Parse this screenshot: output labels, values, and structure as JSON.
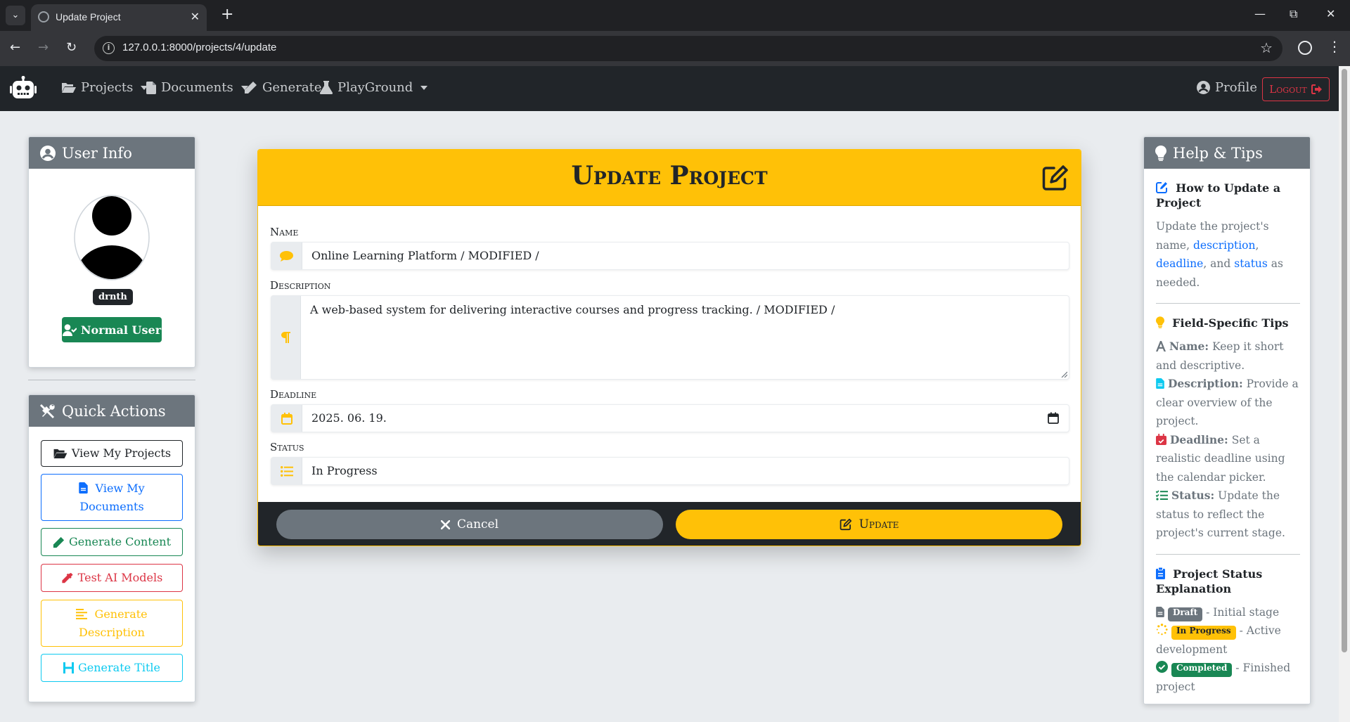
{
  "browser": {
    "tab_title": "Update Project",
    "url": "127.0.0.1:8000/projects/4/update"
  },
  "navbar": {
    "items": [
      {
        "label": "Projects",
        "icon": "folder-open-icon",
        "dropdown": true
      },
      {
        "label": "Documents",
        "icon": "file-icon",
        "dropdown": true
      },
      {
        "label": "Generate",
        "icon": "pencil-icon",
        "dropdown": false
      },
      {
        "label": "PlayGround",
        "icon": "flask-icon",
        "dropdown": true
      }
    ],
    "profile_label": "Profile",
    "logout_label": "Logout"
  },
  "user_info": {
    "title": "User Info",
    "username": "drnth",
    "role": "Normal User"
  },
  "quick_actions": {
    "title": "Quick Actions",
    "buttons": [
      {
        "label": "View My Projects",
        "icon": "folder-open-icon",
        "color": "#212529"
      },
      {
        "label": "View My Documents",
        "icon": "file-icon",
        "color": "#0d6efd"
      },
      {
        "label": "Generate Content",
        "icon": "pencil-icon",
        "color": "#198754"
      },
      {
        "label": "Test AI Models",
        "icon": "eyedropper-icon",
        "color": "#dc3545"
      },
      {
        "label": "Generate Description",
        "icon": "align-left-icon",
        "color": "#ffc107"
      },
      {
        "label": "Generate Title",
        "icon": "heading-icon",
        "color": "#0dcaf0"
      }
    ]
  },
  "form": {
    "title": "Update Project",
    "name_label": "Name",
    "name_value": "Online Learning Platform / MODIFIED /",
    "description_label": "Description",
    "description_value": "A web-based system for delivering interactive courses and progress tracking. / MODIFIED /",
    "deadline_label": "Deadline",
    "deadline_value": "2025. 06. 19.",
    "status_label": "Status",
    "status_value": "In Progress",
    "cancel_label": "Cancel",
    "update_label": "Update"
  },
  "help": {
    "title": "Help & Tips",
    "how_to_title": "How to Update a Project",
    "how_to_text_1": "Update the project's name,",
    "how_to_link_description": "description",
    "how_to_link_deadline": "deadline",
    "how_to_and": ", and",
    "how_to_link_status": "status",
    "how_to_text_2": "as needed.",
    "tips_title": "Field-Specific Tips",
    "tips": [
      {
        "label": "Name:",
        "text": "Keep it short and descriptive.",
        "icon": "font-icon",
        "color": "#6c757d"
      },
      {
        "label": "Description:",
        "text": "Provide a clear overview of the project.",
        "icon": "file-icon",
        "color": "#0dcaf0"
      },
      {
        "label": "Deadline:",
        "text": "Set a realistic deadline using the calendar picker.",
        "icon": "calendar-check-icon",
        "color": "#dc3545"
      },
      {
        "label": "Status:",
        "text": "Update the status to reflect the project's current stage.",
        "icon": "list-check-icon",
        "color": "#198754"
      }
    ],
    "status_title": "Project Status Explanation",
    "statuses": [
      {
        "badge": "Draft",
        "text": "- Initial stage",
        "badge_bg": "#6c757d",
        "badge_fg": "#ffffff",
        "icon": "file-icon"
      },
      {
        "badge": "In Progress",
        "text": "- Active development",
        "badge_bg": "#ffc107",
        "badge_fg": "#212529",
        "icon": "spinner-icon"
      },
      {
        "badge": "Completed",
        "text": "- Finished project",
        "badge_bg": "#198754",
        "badge_fg": "#ffffff",
        "icon": "check-circle-icon"
      }
    ]
  },
  "colors": {
    "warning": "#ffc107",
    "dark": "#212529",
    "secondary": "#6c757d",
    "success": "#198754",
    "danger": "#dc3545",
    "primary": "#0d6efd",
    "info": "#0dcaf0"
  }
}
